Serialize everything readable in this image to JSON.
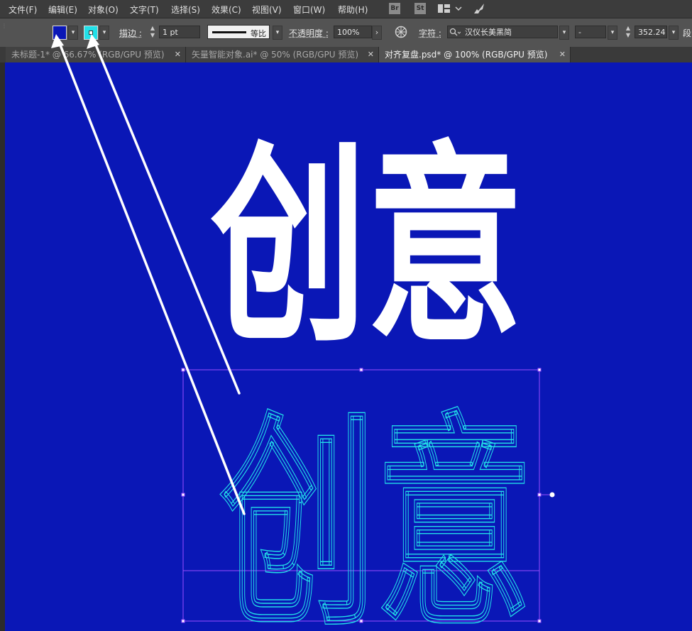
{
  "menu": {
    "items": [
      "文件(F)",
      "编辑(E)",
      "对象(O)",
      "文字(T)",
      "选择(S)",
      "效果(C)",
      "视图(V)",
      "窗口(W)",
      "帮助(H)"
    ],
    "bridge_label": "Br",
    "stock_label": "St"
  },
  "control": {
    "fill_color": "#0a17b6",
    "stroke_color": "#22e0e8",
    "stroke_label": "描边 :",
    "stroke_weight": "1 pt",
    "profile_label": "等比",
    "opacity_label": "不透明度 :",
    "opacity_value": "100%",
    "char_label": "字符 :",
    "font_name": "汉仪长美黑简",
    "font_style": "-",
    "font_size": "352.24",
    "para_label": "段"
  },
  "tabs": [
    {
      "label": "未标题-1* @ 66.67% (RGB/GPU 预览)",
      "active": false
    },
    {
      "label": "矢量智能对象.ai* @ 50% (RGB/GPU 预览)",
      "active": false
    },
    {
      "label": "对齐复盘.psd* @ 100% (RGB/GPU 预览)",
      "active": true
    }
  ],
  "close_glyph": "✕",
  "canvas": {
    "background": "#0a17b6",
    "solid_text": "创意",
    "outline_text": "创意",
    "solid_color": "#ffffff",
    "outline_color": "#22e0e8",
    "selection_color": "#9b4dff"
  }
}
